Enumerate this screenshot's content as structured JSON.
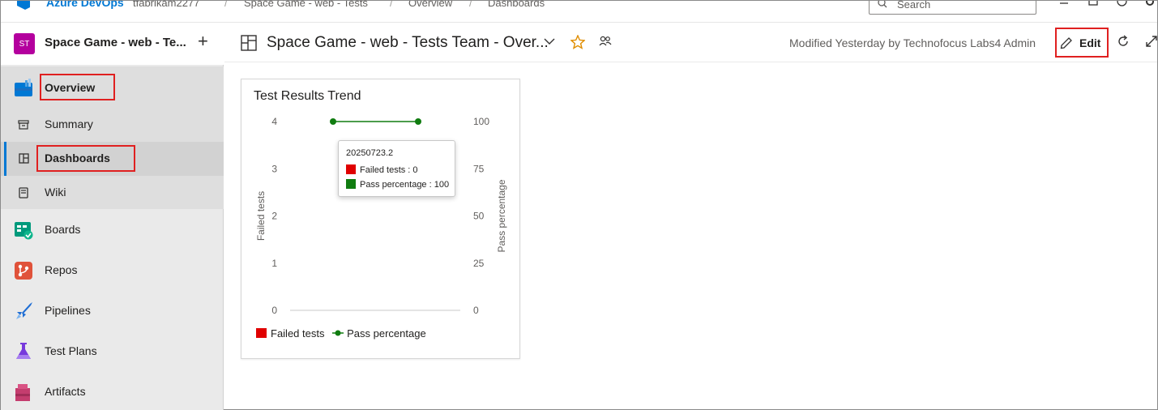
{
  "topbar": {
    "brand": "Azure DevOps",
    "breadcrumbs": [
      "tfabrikam2277",
      "Space Game - web - Tests",
      "Overview",
      "Dashboards"
    ],
    "separator": "/",
    "search_placeholder": "Search"
  },
  "sidebar": {
    "project_initials": "ST",
    "project_name": "Space Game - web - Te...",
    "items": [
      {
        "label": "Overview",
        "icon": "overview-icon"
      },
      {
        "label": "Summary",
        "icon": "summary-icon"
      },
      {
        "label": "Dashboards",
        "icon": "dashboards-icon"
      },
      {
        "label": "Wiki",
        "icon": "wiki-icon"
      },
      {
        "label": "Boards",
        "icon": "boards-icon"
      },
      {
        "label": "Repos",
        "icon": "repos-icon"
      },
      {
        "label": "Pipelines",
        "icon": "pipelines-icon"
      },
      {
        "label": "Test Plans",
        "icon": "test-plans-icon"
      },
      {
        "label": "Artifacts",
        "icon": "artifacts-icon"
      }
    ]
  },
  "header": {
    "title": "Space Game - web - Tests Team - Over...",
    "modified": "Modified Yesterday by Technofocus Labs4 Admin",
    "edit_label": "Edit"
  },
  "widget": {
    "title": "Test Results Trend",
    "tooltip": {
      "build": "20250723.2",
      "failed_label": "Failed tests : 0",
      "pass_label": "Pass percentage : 100"
    }
  },
  "colors": {
    "failed": "#e00000",
    "pass": "#107c10",
    "accent": "#0078d4",
    "highlight": "#e02020"
  },
  "chart_data": {
    "type": "line",
    "title": "Test Results Trend",
    "ylabel": "Failed tests",
    "y2label": "Pass percentage",
    "yticks": [
      "0",
      "1",
      "2",
      "3",
      "4"
    ],
    "y2ticks": [
      "0",
      "25",
      "50",
      "75",
      "100"
    ],
    "ylim": [
      0,
      4
    ],
    "y2lim": [
      0,
      100
    ],
    "series": [
      {
        "name": "Failed tests",
        "type": "bar",
        "values": [
          0,
          0
        ]
      },
      {
        "name": "Pass percentage",
        "type": "line",
        "axis": "right",
        "values": [
          100,
          100
        ]
      }
    ],
    "legend": [
      "Failed tests",
      "Pass percentage"
    ],
    "legend_position": "bottom-left"
  }
}
